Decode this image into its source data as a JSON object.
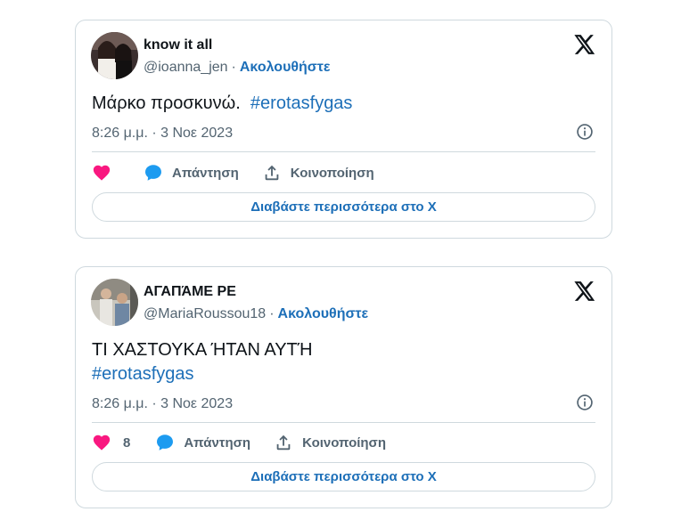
{
  "tweets": [
    {
      "name": "know it all",
      "handle": "@ioanna_jen",
      "separator": "·",
      "follow_label": "Ακολουθήστε",
      "text_plain": "Μάρκο προσκυνώ.",
      "hashtag": "#erotasfygas",
      "timestamp": "8:26 μ.μ. · 3 Νοε 2023",
      "like_count": "",
      "reply_label": "Απάντηση",
      "share_label": "Κοινοποίηση",
      "read_more_label": "Διαβάστε περισσότερα στο Χ"
    },
    {
      "name": "ΑΓΑΠΆΜΕ ΡΕ",
      "handle": "@MariaRoussou18",
      "separator": "·",
      "follow_label": "Ακολουθήστε",
      "text_plain": "ΤΙ ΧΑΣΤΟΥΚΑ ΉΤΑΝ ΑΥΤΉ",
      "hashtag": "#erotasfygas",
      "timestamp": "8:26 μ.μ. · 3 Νοε 2023",
      "like_count": "8",
      "reply_label": "Απάντηση",
      "share_label": "Κοινοποίηση",
      "read_more_label": "Διαβάστε περισσότερα στο Χ"
    }
  ],
  "colors": {
    "like": "#f91880",
    "reply": "#1d9bf0",
    "link": "#1d6fb8",
    "secondary": "#536471",
    "border": "#cfd9de"
  },
  "icons": [
    "x-logo-icon",
    "info-icon",
    "heart-icon",
    "reply-bubble-icon",
    "share-icon"
  ]
}
